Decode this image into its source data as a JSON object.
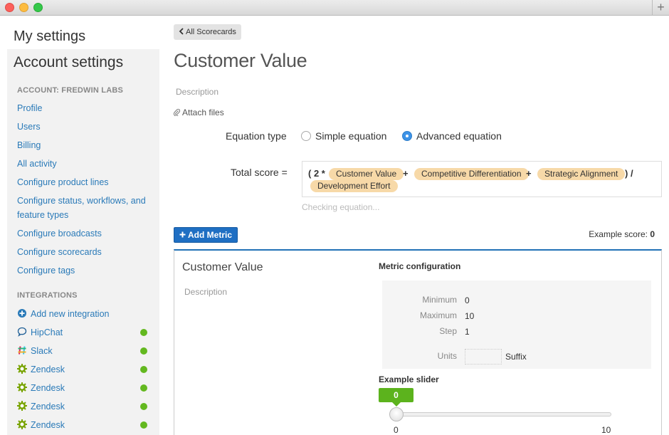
{
  "window": {
    "new_tab_icon": "plus-icon",
    "new_tab_glyph": "+"
  },
  "sidebar": {
    "my_settings": "My settings",
    "account_settings": "Account settings",
    "account_heading": "ACCOUNT: FREDWIN LABS",
    "links": [
      "Profile",
      "Users",
      "Billing",
      "All activity",
      "Configure product lines",
      "Configure status, workflows, and feature types",
      "Configure broadcasts",
      "Configure scorecards",
      "Configure tags"
    ],
    "integrations_heading": "INTEGRATIONS",
    "add_integration": "Add new integration",
    "integrations": [
      {
        "label": "HipChat",
        "icon": "hipchat-icon",
        "status": "connected"
      },
      {
        "label": "Slack",
        "icon": "slack-icon",
        "status": "connected"
      },
      {
        "label": "Zendesk",
        "icon": "zendesk-icon",
        "status": "connected"
      },
      {
        "label": "Zendesk",
        "icon": "zendesk-icon",
        "status": "connected"
      },
      {
        "label": "Zendesk",
        "icon": "zendesk-icon",
        "status": "connected"
      },
      {
        "label": "Zendesk",
        "icon": "zendesk-icon",
        "status": "connected"
      }
    ],
    "status_color": "#63b81f",
    "link_color": "#2a7ab8"
  },
  "main": {
    "back_label": "All Scorecards",
    "title": "Customer Value",
    "description_placeholder": "Description",
    "attach_label": "Attach files",
    "equation_type_label": "Equation type",
    "equation_options": [
      {
        "label": "Simple equation",
        "selected": false
      },
      {
        "label": "Advanced equation",
        "selected": true
      }
    ],
    "total_score_label": "Total score =",
    "equation": {
      "open": "( 2 *",
      "pills": [
        "Customer Value",
        "Competitive Differentiation",
        "Strategic Alignment",
        "Development Effort"
      ],
      "plus1": "+",
      "plus2": "+",
      "close_div": ") /"
    },
    "checking_text": "Checking equation...",
    "add_metric_label": "Add Metric",
    "example_score_label": "Example score:",
    "example_score_value": "0",
    "accent_color": "#1f6fc3",
    "pill_color": "#f7d9a8"
  },
  "metric": {
    "title": "Customer Value",
    "description_placeholder": "Description",
    "config_heading": "Metric configuration",
    "minimum_label": "Minimum",
    "minimum_value": "0",
    "maximum_label": "Maximum",
    "maximum_value": "10",
    "step_label": "Step",
    "step_value": "1",
    "units_label": "Units",
    "units_value": "",
    "suffix_label": "Suffix",
    "slider_heading": "Example slider",
    "slider_value": "0",
    "slider_min_label": "0",
    "slider_max_label": "10"
  }
}
